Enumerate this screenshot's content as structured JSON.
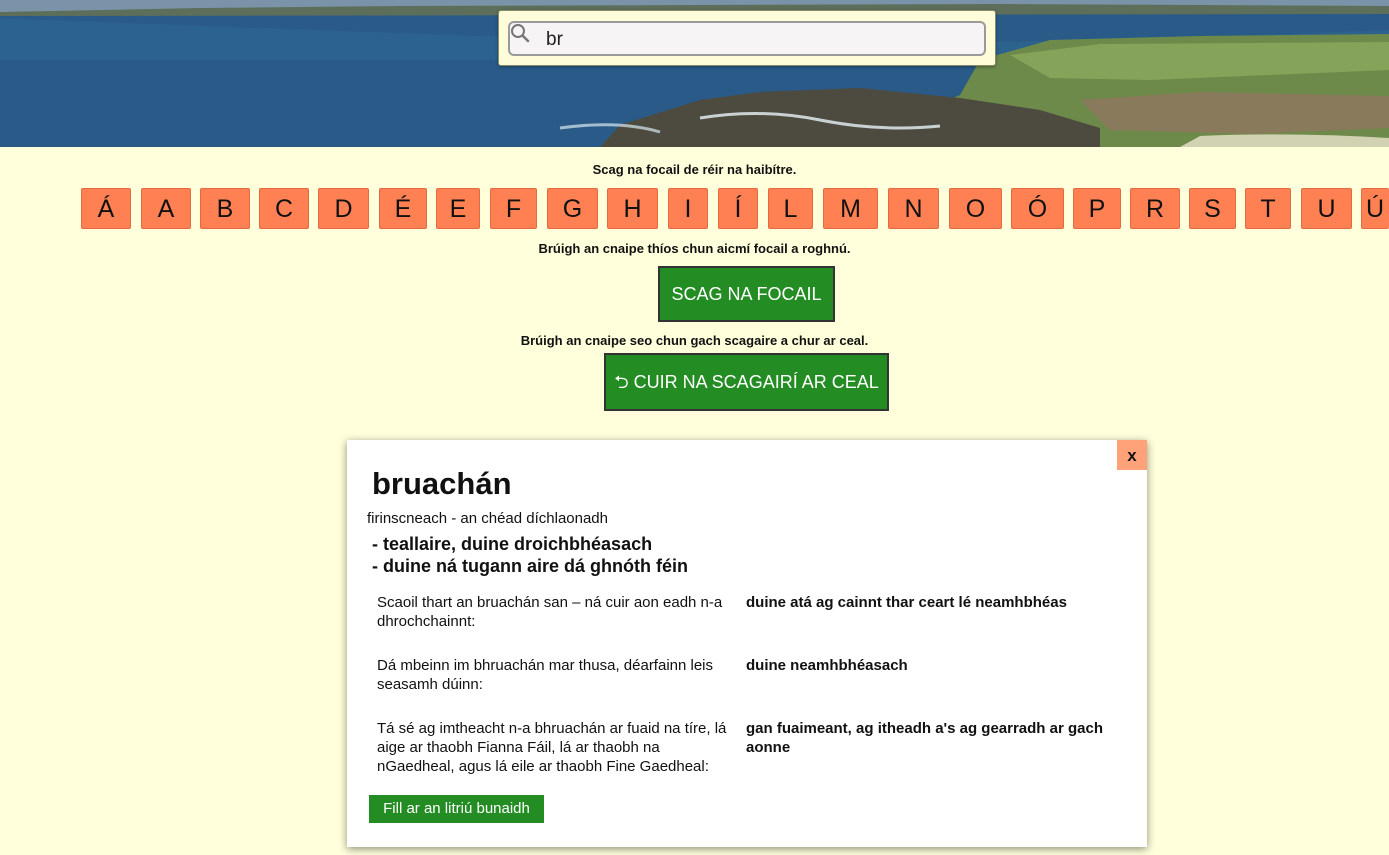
{
  "search": {
    "value": "br",
    "placeholder": ""
  },
  "filters": {
    "letters_hint": "Scag na focail de réir na haibítre.",
    "letters": [
      "Á",
      "A",
      "B",
      "C",
      "D",
      "É",
      "E",
      "F",
      "G",
      "H",
      "I",
      "Í",
      "L",
      "M",
      "N",
      "O",
      "Ó",
      "P",
      "R",
      "S",
      "T",
      "U",
      "Ú"
    ],
    "category_hint": "Brúigh an cnaipe thíos chun aicmí focail a roghnú.",
    "filter_button": "SCAG NA FOCAIL",
    "reset_hint": "Brúigh an cnaipe seo chun gach scagaire a chur ar ceal.",
    "reset_button": "⮌ CUIR NA SCAGAIRÍ AR CEAL"
  },
  "entry": {
    "close_label": "x",
    "word": "bruachán",
    "grammar": "firinscneach - an chéad díchlaonadh",
    "definitions": [
      "- teallaire, duine droichbhéasach",
      "- duine ná tugann aire dá ghnóth féin"
    ],
    "examples": [
      {
        "text": "Scaoil thart an bruachán san – ná cuir aon eadh n-a dhrochchainnt:",
        "meaning": "duine atá ag cainnt thar ceart lé neamhbhéas"
      },
      {
        "text": "Dá mbeinn im bhruachán mar thusa, déarfainn leis seasamh dúinn:",
        "meaning": "duine neamhbhéasach"
      },
      {
        "text": "Tá sé ag imtheacht n-a bhruachán ar fuaid na tíre, lá aige ar thaobh Fianna Fáil, lá ar thaobh na nGaedheal, agus lá eile ar thaobh Fine Gaedheal:",
        "meaning": "gan fuaimeant, ag itheadh a's ag gearradh ar gach aonne"
      }
    ],
    "back_button": "Fill ar an litriú bunaidh"
  },
  "colors": {
    "page_bg": "#ffffdc",
    "letter_button": "#ff8153",
    "action_button": "#238c23",
    "close_button": "#ffa27a"
  }
}
